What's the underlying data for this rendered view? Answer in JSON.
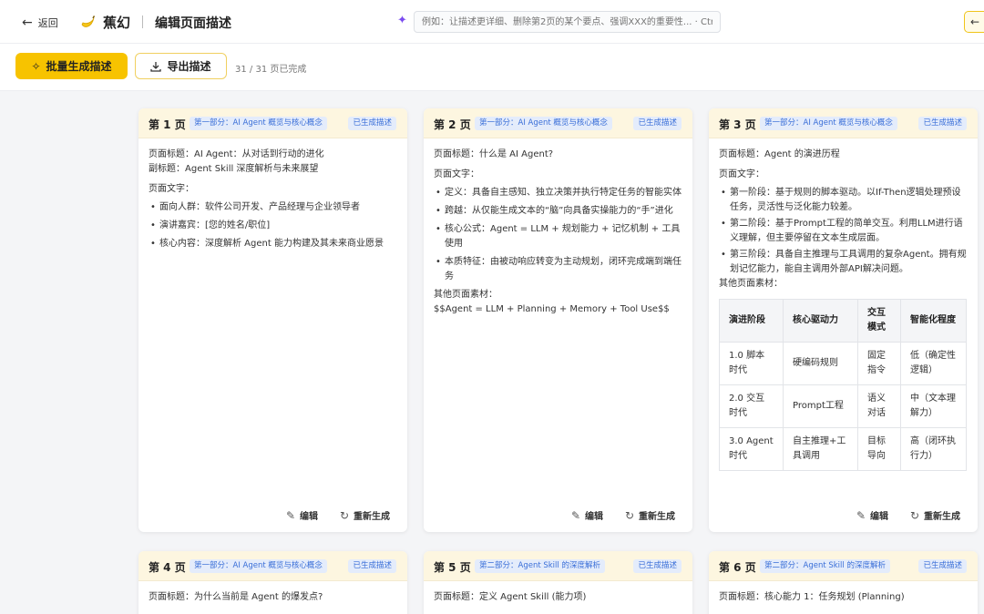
{
  "topbar": {
    "back_label": "返回",
    "brand": "蕉幻",
    "title": "编辑页面描述",
    "ai_input_placeholder": "例如：让描述更详细、删除第2页的某个要点、强调XXX的重要性... · Ctr",
    "right_button_label": "←"
  },
  "toolbar": {
    "batch_label": "批量生成描述",
    "export_label": "导出描述",
    "progress": "31 / 31 页已完成"
  },
  "card_actions": {
    "edit": "编辑",
    "regenerate": "重新生成"
  },
  "cards": [
    {
      "page": "第 1 页",
      "part": "第一部分：AI Agent 概览与核心概念",
      "status": "已生成描述",
      "title_line": "页面标题：AI Agent：从对话到行动的进化",
      "subtitle_line": "副标题：Agent Skill 深度解析与未来展望",
      "text_label": "页面文字：",
      "bullets": [
        "面向人群：软件公司开发、产品经理与企业领导者",
        "演讲嘉宾：[您的姓名/职位]",
        "核心内容：深度解析 Agent 能力构建及其未来商业愿景"
      ]
    },
    {
      "page": "第 2 页",
      "part": "第一部分：AI Agent 概览与核心概念",
      "status": "已生成描述",
      "title_line": "页面标题：什么是 AI Agent?",
      "text_label": "页面文字：",
      "bullets": [
        "定义：具备自主感知、独立决策并执行特定任务的智能实体",
        "跨越：从仅能生成文本的“脑”向具备实操能力的“手”进化",
        "核心公式：Agent = LLM + 规划能力 + 记忆机制 + 工具使用",
        "本质特征：由被动响应转变为主动规划，闭环完成端到端任务"
      ],
      "other_label": "其他页面素材：",
      "other_value": "$$Agent = LLM + Planning + Memory + Tool Use$$"
    },
    {
      "page": "第 3 页",
      "part": "第一部分：AI Agent 概览与核心概念",
      "status": "已生成描述",
      "title_line": "页面标题：Agent 的演进历程",
      "text_label": "页面文字：",
      "bullets": [
        "第一阶段：基于规则的脚本驱动。以If-Then逻辑处理预设任务，灵活性与泛化能力较差。",
        "第二阶段：基于Prompt工程的简单交互。利用LLM进行语义理解，但主要停留在文本生成层面。",
        "第三阶段：具备自主推理与工具调用的复杂Agent。拥有规划记忆能力，能自主调用外部API解决问题。"
      ],
      "other_label": "其他页面素材：",
      "table": {
        "headers": [
          "演进阶段",
          "核心驱动力",
          "交互模式",
          "智能化程度"
        ],
        "rows": [
          [
            "1.0 脚本时代",
            "硬编码规则",
            "固定指令",
            "低（确定性逻辑）"
          ],
          [
            "2.0 交互时代",
            "Prompt工程",
            "语义对话",
            "中（文本理解力）"
          ],
          [
            "3.0 Agent时代",
            "自主推理+工具调用",
            "目标导向",
            "高（闭环执行力）"
          ]
        ]
      }
    },
    {
      "page": "第 4 页",
      "part": "第一部分：AI Agent 概览与核心概念",
      "status": "已生成描述",
      "title_line": "页面标题：为什么当前是 Agent 的爆发点?"
    },
    {
      "page": "第 5 页",
      "part": "第二部分：Agent Skill 的深度解析",
      "status": "已生成描述",
      "title_line": "页面标题：定义 Agent Skill (能力项)"
    },
    {
      "page": "第 6 页",
      "part": "第二部分：Agent Skill 的深度解析",
      "status": "已生成描述",
      "title_line": "页面标题：核心能力 1：任务规划 (Planning)"
    }
  ]
}
